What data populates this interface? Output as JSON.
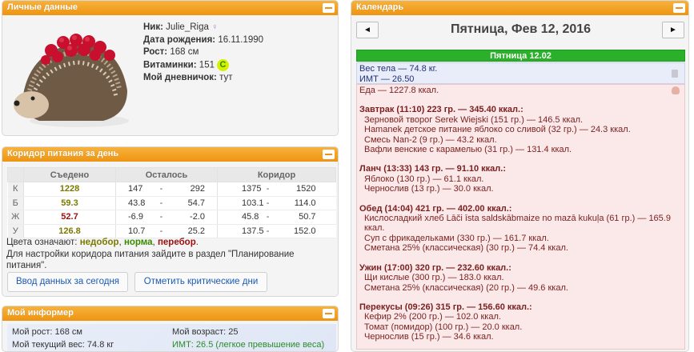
{
  "personal": {
    "header": "Личные данные",
    "nick_label": "Ник:",
    "nick": "Julie_Riga",
    "gender_symbol": "♀",
    "birth_label": "Дата рождения:",
    "birth": "16.11.1990",
    "height_label": "Рост:",
    "height": "168 см",
    "vitamins_label": "Витаминки:",
    "vitamins": "151",
    "vitamins_badge": "C",
    "diary_label": "Мой дневничок:",
    "diary_link": "тут"
  },
  "corridor": {
    "header": "Коридор питания за день",
    "columns": [
      "Съедено",
      "Осталось",
      "Коридор"
    ],
    "rows": [
      {
        "label": "К",
        "eaten": "1228",
        "eaten_color": "#7a7a00",
        "left_min": "147",
        "left_max": "292",
        "corr_min": "1375",
        "corr_max": "1520"
      },
      {
        "label": "Б",
        "eaten": "59.3",
        "eaten_color": "#7a7a00",
        "left_min": "43.8",
        "left_max": "54.7",
        "corr_min": "103.1",
        "corr_max": "114.0"
      },
      {
        "label": "Ж",
        "eaten": "52.7",
        "eaten_color": "#9a1010",
        "left_min": "-6.9",
        "left_max": "-2.0",
        "corr_min": "45.8",
        "corr_max": "50.7"
      },
      {
        "label": "У",
        "eaten": "126.8",
        "eaten_color": "#7a7a00",
        "left_min": "10.7",
        "left_max": "25.2",
        "corr_min": "137.5",
        "corr_max": "152.0"
      }
    ],
    "dash": "-",
    "legend_prefix": "Цвета означают:",
    "legend_under": "недобор",
    "legend_norm": "норма",
    "legend_over": "перебор",
    "legend_sep": ",",
    "legend_end": ".",
    "settings_text": "Для настройки коридора питания зайдите в раздел \"Планирование питания\".",
    "btn_today": "Ввод данных за сегодня",
    "btn_critical": "Отметить критические дни"
  },
  "informer": {
    "header": "Мой информер",
    "height": "Мой рост: 168 см",
    "age": "Мой возраст: 25",
    "weight": "Мой текущий вес: 74.8 кг",
    "bmi": "ИМТ: 26.5 (легкое превышение веса)"
  },
  "calendar": {
    "header": "Календарь",
    "prev": "◄",
    "next": "►",
    "date_title": "Пятница, Фев 12, 2016",
    "day_bar": "Пятница 12.02",
    "weight_line": "Вес тела — 74.8 кг.",
    "bmi_line": "ИМТ — 26.50",
    "food_total": "Еда — 1227.8 ккал.",
    "meals": [
      {
        "title": "Завтрак (11:10) 223 гр. — 345.40 ккал.:",
        "items": [
          "Зерновой творог Serek Wiejski (151 гр.) — 146.5 ккал.",
          "Hamanek детское питание яблоко со сливой (32 гр.) — 24.3 ккал.",
          "Смесь Nan-2 (9 гр.) — 43.2 ккал.",
          "Вафли венские с карамелью (31 гр.) — 131.4 ккал."
        ]
      },
      {
        "title": "Ланч (13:33) 143 гр. — 91.10 ккал.:",
        "items": [
          "Яблоко (130 гр.) — 61.1 ккал.",
          "Чернослив (13 гр.) — 30.0 ккал."
        ]
      },
      {
        "title": "Обед (14:04) 421 гр. — 402.00 ккал.:",
        "items": [
          "Кисло­сладкий хлеб Lāči īsta saldskābmaize no mazā kukuļa (61 гр.) — 165.9 ккал.",
          "Суп с фрикадельками (330 гр.) — 161.7 ккал.",
          "Сметана 25% (классическая) (30 гр.) — 74.4 ккал."
        ]
      },
      {
        "title": "Ужин (17:00) 320 гр. — 232.60 ккал.:",
        "items": [
          "Щи кислые (300 гр.) — 183.0 ккал.",
          "Сметана 25% (классическая) (20 гр.) — 49.6 ккал."
        ]
      },
      {
        "title": "Перекусы (09:26) 315 гр. — 156.60 ккал.:",
        "items": [
          "Кефир 2% (200 гр.) — 102.0 ккал.",
          "Томат (помидор) (100 гр.) — 20.0 ккал.",
          "Чернослив (15 гр.) — 34.6 ккал."
        ]
      }
    ]
  }
}
